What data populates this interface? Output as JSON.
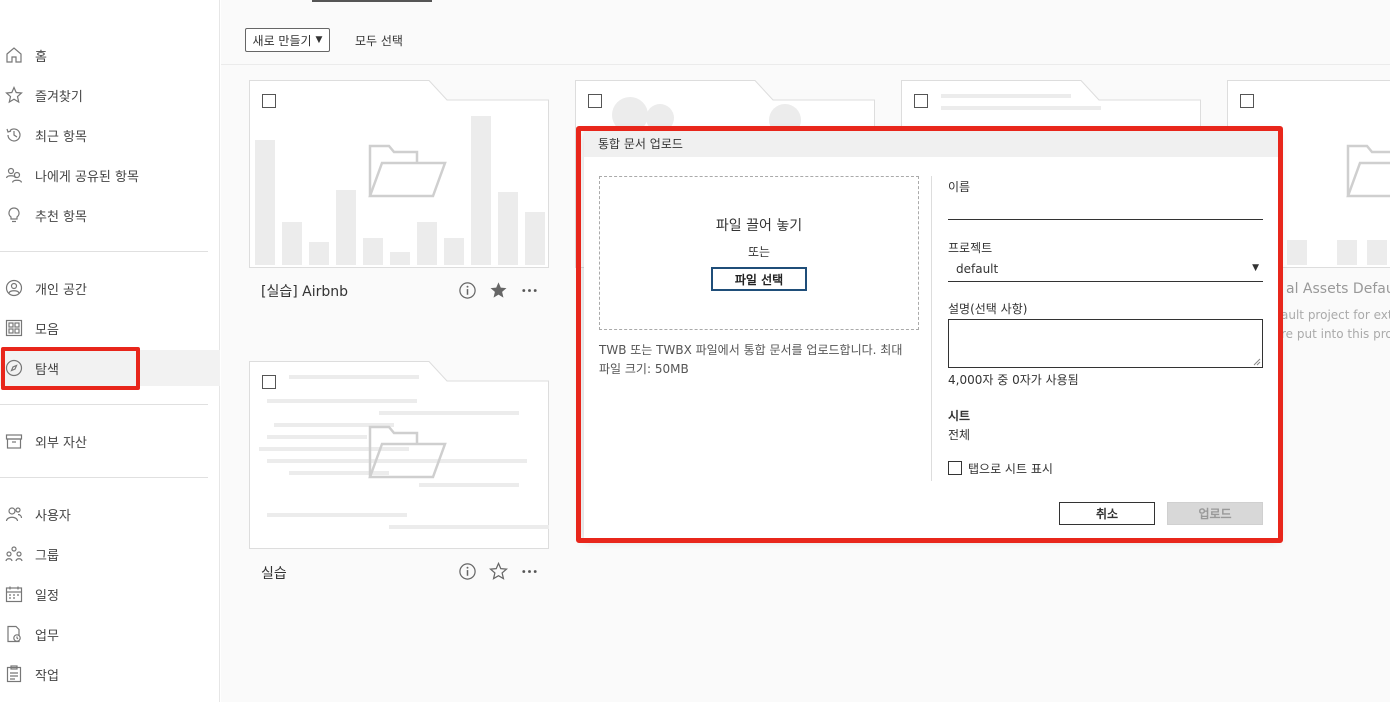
{
  "sidebar": {
    "items": [
      {
        "label": "홈",
        "icon": "home-icon"
      },
      {
        "label": "즐겨찾기",
        "icon": "star-icon"
      },
      {
        "label": "최근 항목",
        "icon": "history-icon"
      },
      {
        "label": "나에게 공유된 항목",
        "icon": "shared-users-icon"
      },
      {
        "label": "추천 항목",
        "icon": "lightbulb-icon"
      },
      {
        "label": "개인 공간",
        "icon": "person-icon"
      },
      {
        "label": "모음",
        "icon": "collection-icon"
      },
      {
        "label": "탐색",
        "icon": "compass-icon"
      },
      {
        "label": "외부 자산",
        "icon": "box-icon"
      },
      {
        "label": "사용자",
        "icon": "user-icon"
      },
      {
        "label": "그룹",
        "icon": "group-icon"
      },
      {
        "label": "일정",
        "icon": "calendar-icon"
      },
      {
        "label": "업무",
        "icon": "task-icon"
      },
      {
        "label": "작업",
        "icon": "clipboard-icon"
      }
    ],
    "active_item": "탐색",
    "highlight_color": "#e8261b"
  },
  "toolbar": {
    "new_label": "새로 만들기",
    "select_all_label": "모두 선택"
  },
  "cards": [
    {
      "title": "[실습] Airbnb",
      "favorited": true
    },
    {
      "title": "실습",
      "favorited": false
    },
    {
      "title_partial": "al Assets Default",
      "desc_line1": "ault project for exter",
      "desc_line2": "re put into this proje"
    }
  ],
  "dialog": {
    "title": "통합 문서 업로드",
    "dropzone": {
      "title": "파일 끌어 놓기",
      "or": "또는",
      "choose_file": "파일 선택"
    },
    "help_text": "TWB 또는 TWBX 파일에서 통합 문서를 업로드합니다. 최대 파일 크기: 50MB",
    "name_label": "이름",
    "name_value": "",
    "project_label": "프로젝트",
    "project_value": "default",
    "description_label": "설명(선택 사항)",
    "description_value": "",
    "char_counter": "4,000자 중 0자가 사용됨",
    "sheets_label": "시트",
    "sheets_value": "전체",
    "show_tabs_label": "탭으로 시트 표시",
    "show_tabs_checked": false,
    "cancel_label": "취소",
    "upload_label": "업로드",
    "upload_enabled": false
  }
}
